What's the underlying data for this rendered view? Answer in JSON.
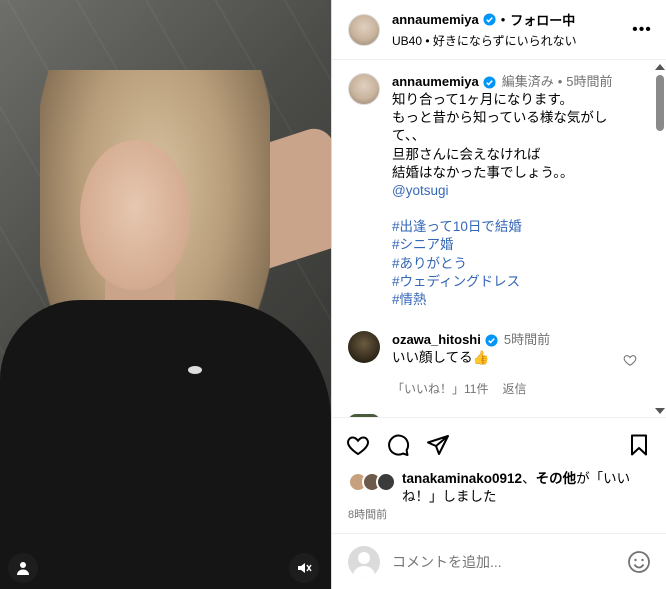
{
  "header": {
    "username": "annaumemiya",
    "follow_status": "フォロー中",
    "audio": "UB40 • 好きにならずにいられない"
  },
  "caption": {
    "username": "annaumemiya",
    "edited": "編集済み",
    "time": "5時間前",
    "lines": [
      "知り合って1ヶ月になります。",
      "もっと昔から知っている様な気がし",
      "て、、",
      "旦那さんに会えなければ",
      "結婚はなかった事でしょう。。"
    ],
    "mention": "@yotsugi",
    "hashtags": [
      "#出逢って10日で結婚",
      "#シニア婚",
      "#ありがとう",
      "#ウェディングドレス",
      "#情熱"
    ]
  },
  "comments": [
    {
      "username": "ozawa_hitoshi",
      "time": "5時間前",
      "text": "いい顔してる👍",
      "likes": "「いいね！」11件",
      "reply": "返信"
    }
  ],
  "likes_summary": {
    "user": "tanakaminako0912",
    "sep": "、",
    "others": "その他",
    "suffix": "が「いいね！」しました"
  },
  "post_time": "8時間前",
  "comment_input": {
    "placeholder": "コメントを追加..."
  },
  "colors": {
    "verified": "#0095f6",
    "link": "#3567b7",
    "secondary_text": "#737373"
  }
}
